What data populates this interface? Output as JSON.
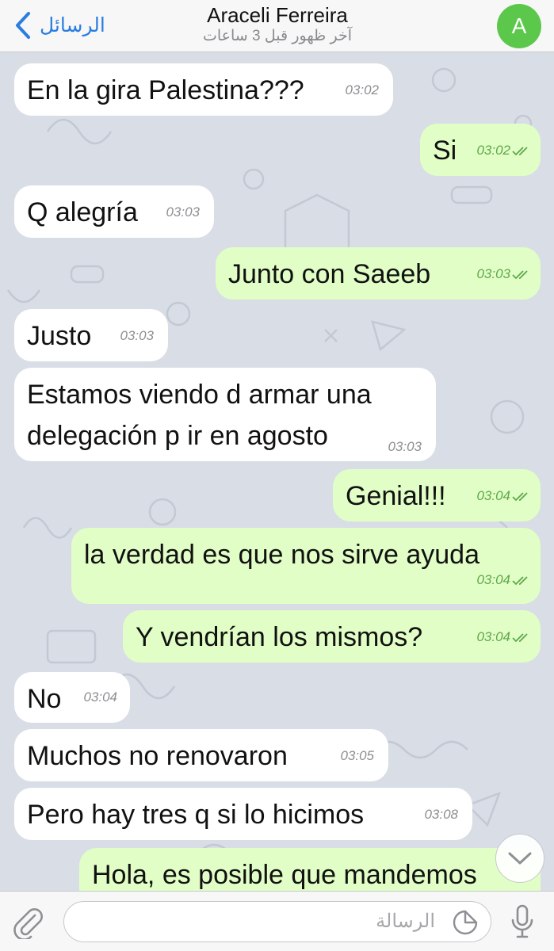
{
  "header": {
    "back_label": "الرسائل",
    "title": "Araceli Ferreira",
    "subtitle": "آخر ظهور قبل 3 ساعات",
    "avatar_letter": "A"
  },
  "messages": [
    {
      "dir": "in",
      "text": "En la gira Palestina???",
      "time": "03:02"
    },
    {
      "dir": "out",
      "text": "Si",
      "time": "03:02",
      "read": true
    },
    {
      "dir": "in",
      "text": "Q alegría",
      "time": "03:03"
    },
    {
      "dir": "out",
      "text": "Junto con Saeeb",
      "time": "03:03",
      "read": true
    },
    {
      "dir": "in",
      "text": "Justo",
      "time": "03:03"
    },
    {
      "dir": "in",
      "text": "Estamos viendo d armar una",
      "text2": "delegación p ir en agosto",
      "time": "03:03"
    },
    {
      "dir": "out",
      "text": "Genial!!!",
      "time": "03:04",
      "read": true
    },
    {
      "dir": "out",
      "text": "la verdad es que nos sirve ayuda",
      "time": "03:04",
      "read": true
    },
    {
      "dir": "out",
      "text": "Y vendrían los mismos?",
      "time": "03:04",
      "read": true
    },
    {
      "dir": "in",
      "text": "No",
      "time": "03:04"
    },
    {
      "dir": "in",
      "text": "Muchos no renovaron",
      "time": "03:05"
    },
    {
      "dir": "in",
      "text": "Pero hay tres q si lo hicimos",
      "time": "03:08"
    },
    {
      "dir": "out",
      "text": "Hola, es posible que mandemos"
    }
  ],
  "input": {
    "placeholder": "الرسالة"
  },
  "colors": {
    "accent": "#2a7de1",
    "outgoing_bubble": "#e1fec6",
    "incoming_bubble": "#ffffff",
    "check": "#5ea84a",
    "avatar": "#5bc84b"
  },
  "icons": [
    "back-chevron-icon",
    "scroll-down-icon",
    "paperclip-icon",
    "sticker-icon",
    "microphone-icon",
    "double-check-icon"
  ]
}
